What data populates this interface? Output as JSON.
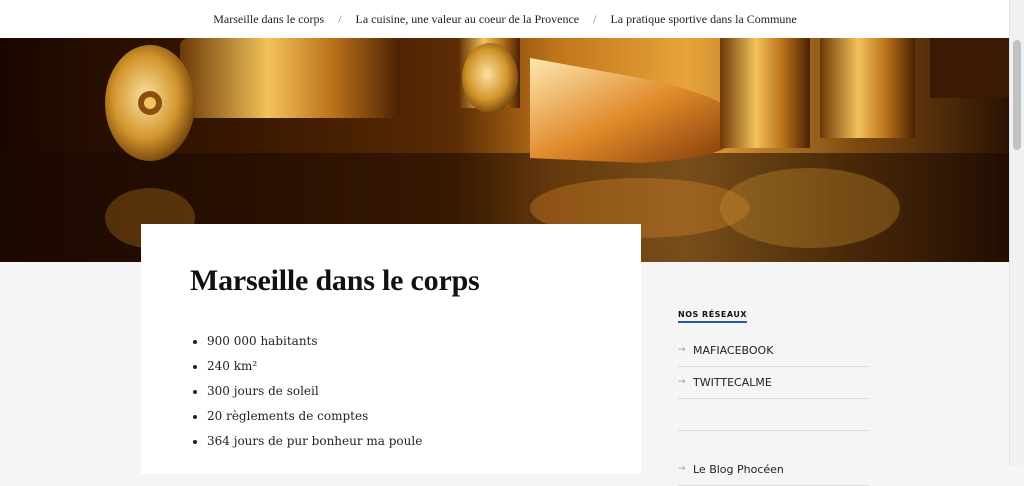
{
  "nav": {
    "items": [
      {
        "label": "Marseille dans le corps"
      },
      {
        "label": "La cuisine, une valeur au coeur de la Provence"
      },
      {
        "label": "La pratique sportive dans la Commune"
      }
    ],
    "separator": "/"
  },
  "main": {
    "title": "Marseille dans le corps",
    "list": [
      "900 000 habitants",
      "240 km²",
      "300 jours de soleil",
      "20 règlements de comptes",
      "364 jours de pur bonheur ma poule"
    ]
  },
  "sidebar": {
    "widget_title": "NOS RÉSEAUX",
    "networks": [
      "MAFIACEBOOK",
      "TWITTECALME"
    ],
    "links": [
      "Le Blog Phocéen"
    ],
    "arrow_glyph": "→"
  },
  "hero": {
    "image": "bullets-icon"
  },
  "colors": {
    "accent": "#2c5aa0",
    "background": "#f5f5f5",
    "card": "#ffffff"
  }
}
